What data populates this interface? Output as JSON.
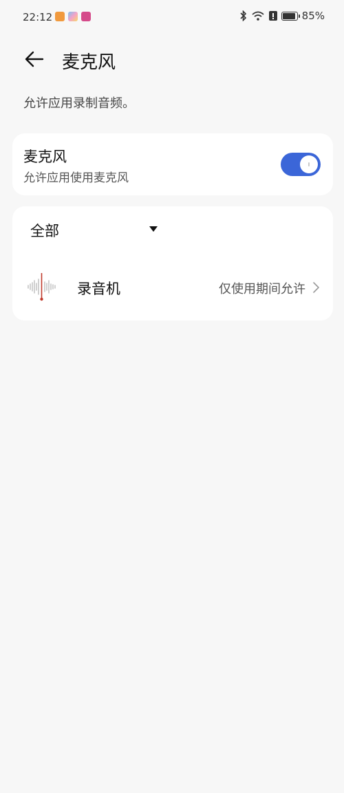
{
  "status_bar": {
    "time": "22:12",
    "battery": "85%"
  },
  "header": {
    "title": "麦克风"
  },
  "description": "允许应用录制音频。",
  "mic_toggle": {
    "label": "麦克风",
    "sublabel": "允许应用使用麦克风",
    "enabled": true
  },
  "filter": {
    "selected": "全部"
  },
  "apps": [
    {
      "name": "录音机",
      "permission": "仅使用期间允许",
      "icon": "voice-recorder-icon"
    }
  ],
  "colors": {
    "accent": "#3b66d8",
    "background": "#f7f7f7",
    "card": "#ffffff"
  }
}
